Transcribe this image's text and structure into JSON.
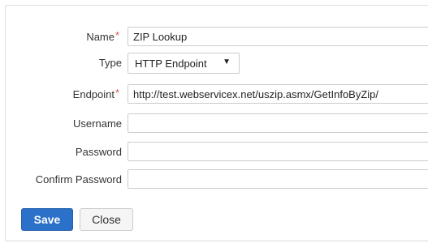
{
  "form": {
    "name": {
      "label": "Name",
      "required": "*",
      "value": "ZIP Lookup"
    },
    "type": {
      "label": "Type",
      "value": "HTTP Endpoint"
    },
    "endpoint": {
      "label": "Endpoint",
      "required": "*",
      "value": "http://test.webservicex.net/uszip.asmx/GetInfoByZip/"
    },
    "username": {
      "label": "Username",
      "value": ""
    },
    "password": {
      "label": "Password",
      "value": ""
    },
    "confirm_password": {
      "label": "Confirm Password",
      "value": ""
    }
  },
  "buttons": {
    "save_label": "Save",
    "close_label": "Close"
  },
  "colors": {
    "primary": "#2b70c9",
    "required": "#d9534f"
  }
}
